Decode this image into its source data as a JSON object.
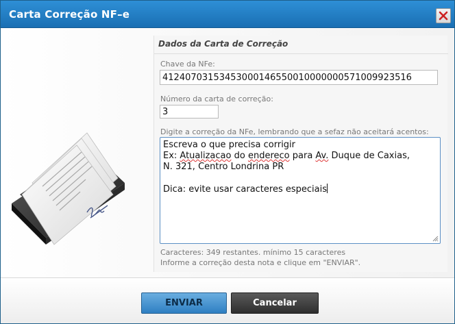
{
  "dialog": {
    "title": "Carta Correção NF–e"
  },
  "panel": {
    "title": "Dados da Carta de Correção",
    "key_label": "Chave da NFe:",
    "key_value": "41240703153453000146550010000000571009923516",
    "number_label": "Número da carta de correção:",
    "number_value": "3",
    "correction_label": "Digite a correção da NFe, lembrando que a sefaz não aceitará acentos:",
    "correction_lines": {
      "l1": "Escreva o que precisa corrigir",
      "l2_a": "Ex: ",
      "l2_b": "Atualizacao",
      "l2_c": " do ",
      "l2_d": "endereco",
      "l2_e": " para ",
      "l2_f": "Av.",
      "l2_g": " Duque de Caxias,",
      "l3": "N. 321, Centro Londrina PR",
      "l4": "",
      "l5": "Dica: evite usar caracteres especiais"
    },
    "counter_text": "Caracteres: 349 restantes. mínimo 15 caracteres",
    "hint_text": "Informe a correção desta nota e clique em \"ENVIAR\"."
  },
  "footer": {
    "send_label": "ENVIAR",
    "cancel_label": "Cancelar"
  },
  "colors": {
    "titlebar": "#1f7cc2",
    "send_button": "#3a8ccc",
    "cancel_button": "#3a3a3a",
    "close_x": "#cc2222"
  }
}
